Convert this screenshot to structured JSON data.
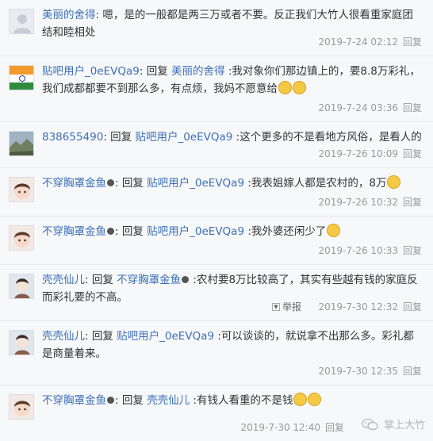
{
  "comments": [
    {
      "avatar": "default-avatar",
      "segments": [
        {
          "t": "user",
          "v": "美丽的舍得"
        },
        {
          "t": "plain",
          "v": ": 嗯，是的一般都是两三万或者不要。反正我们大竹人很看重家庭团结和睦相处"
        }
      ],
      "time": "2019-7-24 02:12",
      "reply": "回复"
    },
    {
      "avatar": "india-flag-avatar",
      "segments": [
        {
          "t": "user",
          "v": "贴吧用户_0eEVQa9"
        },
        {
          "t": "plain",
          "v": ": 回复 "
        },
        {
          "t": "user",
          "v": "美丽的舍得"
        },
        {
          "t": "plain",
          "v": " :我对象你们那边镇上的，要8.8万彩礼，我们成都都要不到那么多，有点烦，我妈不愿意给"
        }
      ],
      "faces": 2,
      "time": "2019-7-24 03:36",
      "reply": "回复"
    },
    {
      "avatar": "landscape-avatar",
      "segments": [
        {
          "t": "user",
          "v": "838655490"
        },
        {
          "t": "plain",
          "v": ": 回复 "
        },
        {
          "t": "user",
          "v": "贴吧用户_0eEVQa9"
        },
        {
          "t": "plain",
          "v": " :这个更多的不是看地方风俗，是看人的"
        }
      ],
      "time": "2019-7-26 10:09",
      "reply": "回复"
    },
    {
      "avatar": "child-avatar",
      "segments": [
        {
          "t": "user",
          "v": "不穿胸罩金鱼"
        },
        {
          "t": "plain",
          "v": ": 回复 "
        },
        {
          "t": "user",
          "v": "贴吧用户_0eEVQa9"
        },
        {
          "t": "plain",
          "v": " :我表姐嫁人都是农村的，8万"
        }
      ],
      "dot": true,
      "faces": 1,
      "time": "2019-7-26 10:32",
      "reply": "回复"
    },
    {
      "avatar": "child-avatar",
      "segments": [
        {
          "t": "user",
          "v": "不穿胸罩金鱼"
        },
        {
          "t": "plain",
          "v": ": 回复 "
        },
        {
          "t": "user",
          "v": "贴吧用户_0eEVQa9"
        },
        {
          "t": "plain",
          "v": " :我外婆还闲少了"
        }
      ],
      "dot": true,
      "faces": 1,
      "time": "2019-7-26 10:33",
      "reply": "回复"
    },
    {
      "avatar": "cartoon-avatar",
      "segments": [
        {
          "t": "user",
          "v": "壳壳仙儿"
        },
        {
          "t": "plain",
          "v": ": 回复 "
        },
        {
          "t": "user",
          "v": "不穿胸罩金鱼"
        },
        {
          "t": "plain",
          "v": " :农村要8万比较高了，其实有些越有钱的家庭反而彩礼要的不高。"
        }
      ],
      "dot_after_second_user": true,
      "report": "举报",
      "time": "2019-7-30 12:32",
      "reply": "回复"
    },
    {
      "avatar": "cartoon-avatar",
      "segments": [
        {
          "t": "user",
          "v": "壳壳仙儿"
        },
        {
          "t": "plain",
          "v": ": 回复 "
        },
        {
          "t": "user",
          "v": "贴吧用户_0eEVQa9"
        },
        {
          "t": "plain",
          "v": " :可以谈谈的，就说拿不出那么多。彩礼都是商量着来。"
        }
      ],
      "time": "2019-7-30 12:35",
      "reply": "回复"
    },
    {
      "avatar": "child-avatar",
      "segments": [
        {
          "t": "user",
          "v": "不穿胸罩金鱼"
        },
        {
          "t": "plain",
          "v": ": 回复 "
        },
        {
          "t": "user",
          "v": "壳壳仙儿"
        },
        {
          "t": "plain",
          "v": " :有钱人看重的不是钱"
        }
      ],
      "dot": true,
      "faces": 2,
      "time": "2019-7-30 12:40",
      "reply": "回复"
    }
  ],
  "watermark": "掌上大竹",
  "colors": {
    "link": "#3b6fb6",
    "meta": "#999999",
    "bg": "#f7f8fa"
  }
}
